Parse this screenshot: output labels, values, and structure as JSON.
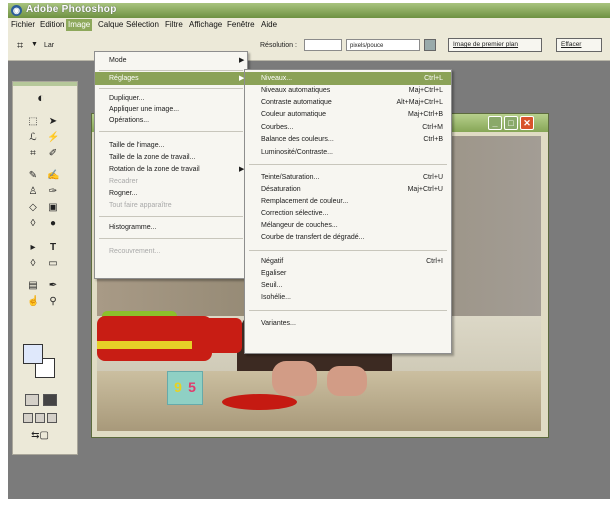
{
  "app": {
    "title": "Adobe Photoshop",
    "icon": "ps-logo-icon"
  },
  "menubar": [
    "Fichier",
    "Edition",
    "Image",
    "Calque",
    "Sélection",
    "Filtre",
    "Affichage",
    "Fenêtre",
    "Aide"
  ],
  "options_bar": {
    "tool_icon": "crop-icon",
    "width_label": "Lar",
    "resolution_label": "Résolution :",
    "resolution_value": "",
    "units": "pixels/pouce",
    "front_image_button": "Image de premier plan",
    "clear_button": "Effacer"
  },
  "image_menu": {
    "items": [
      {
        "label": "Mode",
        "submenu": true
      },
      {
        "separator": true
      },
      {
        "label": "Réglages",
        "submenu": true,
        "highlighted": true
      },
      {
        "separator": true
      },
      {
        "label": "Dupliquer..."
      },
      {
        "label": "Appliquer une image..."
      },
      {
        "label": "Opérations..."
      },
      {
        "separator": true
      },
      {
        "label": "Taille de l'image..."
      },
      {
        "label": "Taille de la zone de travail..."
      },
      {
        "label": "Rotation de la zone de travail",
        "submenu": true
      },
      {
        "label": "Recadrer",
        "disabled": true
      },
      {
        "label": "Rogner..."
      },
      {
        "label": "Tout faire apparaître",
        "disabled": true
      },
      {
        "separator": true
      },
      {
        "label": "Histogramme..."
      },
      {
        "separator": true
      },
      {
        "label": "Recouvrement...",
        "disabled": true
      }
    ]
  },
  "adjust_menu": {
    "items": [
      {
        "label": "Niveaux...",
        "shortcut": "Ctrl+L",
        "highlighted": true
      },
      {
        "label": "Niveaux automatiques",
        "shortcut": "Maj+Ctrl+L"
      },
      {
        "label": "Contraste automatique",
        "shortcut": "Alt+Maj+Ctrl+L"
      },
      {
        "label": "Couleur automatique",
        "shortcut": "Maj+Ctrl+B"
      },
      {
        "label": "Courbes...",
        "shortcut": "Ctrl+M"
      },
      {
        "label": "Balance des couleurs...",
        "shortcut": "Ctrl+B"
      },
      {
        "label": "Luminosité/Contraste..."
      },
      {
        "separator": true
      },
      {
        "label": "Teinte/Saturation...",
        "shortcut": "Ctrl+U"
      },
      {
        "label": "Désaturation",
        "shortcut": "Maj+Ctrl+U"
      },
      {
        "label": "Remplacement de couleur..."
      },
      {
        "label": "Correction sélective..."
      },
      {
        "label": "Mélangeur de couches..."
      },
      {
        "label": "Courbe de transfert de dégradé..."
      },
      {
        "separator": true
      },
      {
        "label": "Négatif",
        "shortcut": "Ctrl+I"
      },
      {
        "label": "Egaliser"
      },
      {
        "label": "Seuil..."
      },
      {
        "label": "Isohélie..."
      },
      {
        "separator": true
      },
      {
        "label": "Variantes..."
      }
    ]
  },
  "document": {
    "cube_digit_1": "9",
    "cube_digit_2": "5"
  },
  "colors": {
    "accent": "#8ba257",
    "titlebar": "#86a656",
    "close": "#d8532c"
  }
}
